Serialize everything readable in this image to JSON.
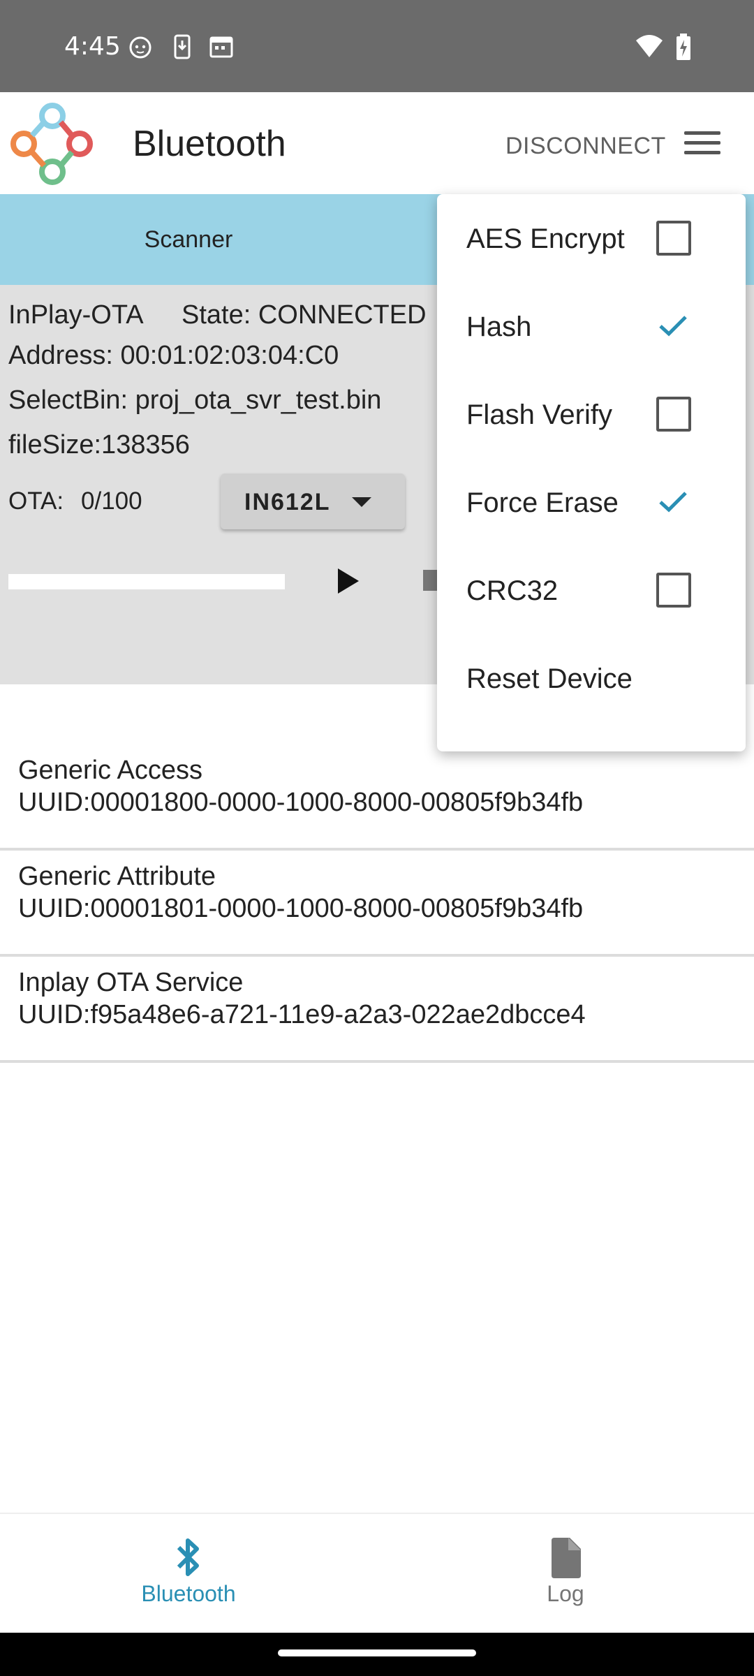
{
  "status_bar": {
    "time": "4:45"
  },
  "app_bar": {
    "title": "Bluetooth",
    "disconnect_label": "DISCONNECT"
  },
  "tabs": {
    "scanner_label": "Scanner"
  },
  "device": {
    "name": "InPlay-OTA",
    "state": "State: CONNECTED",
    "address": "Address: 00:01:02:03:04:C0",
    "select_bin": "SelectBin: proj_ota_svr_test.bin",
    "file_size": "fileSize:138356",
    "ota_label": "OTA:",
    "ota_progress_text": "0/100",
    "chip_selected": "IN612L",
    "progress_fraction": 0
  },
  "services": [
    {
      "name": "Generic Access",
      "uuid": "UUID:00001800-0000-1000-8000-00805f9b34fb"
    },
    {
      "name": "Generic Attribute",
      "uuid": "UUID:00001801-0000-1000-8000-00805f9b34fb"
    },
    {
      "name": "Inplay OTA Service",
      "uuid": "UUID:f95a48e6-a721-11e9-a2a3-022ae2dbcce4"
    }
  ],
  "menu": {
    "items": [
      {
        "label": "AES Encrypt",
        "checked": false
      },
      {
        "label": "Hash",
        "checked": true
      },
      {
        "label": "Flash Verify",
        "checked": false
      },
      {
        "label": "Force Erase",
        "checked": true
      },
      {
        "label": "CRC32",
        "checked": false
      },
      {
        "label": "Reset Device"
      }
    ]
  },
  "bottom_nav": {
    "bluetooth_label": "Bluetooth",
    "log_label": "Log"
  },
  "colors": {
    "accent": "#2a8fb4",
    "tab_bar": "#9ad3e6",
    "status_bar": "#6b6b6b",
    "panel": "#e0e0e0"
  },
  "icons": {
    "status": [
      "cat-notification-icon",
      "download-icon",
      "calendar-icon",
      "wifi-icon",
      "battery-charging-icon"
    ],
    "app_logo": "inplay-logo-icon",
    "menu": "hamburger-menu-icon",
    "nav": [
      "bluetooth-icon",
      "log-file-icon"
    ]
  }
}
